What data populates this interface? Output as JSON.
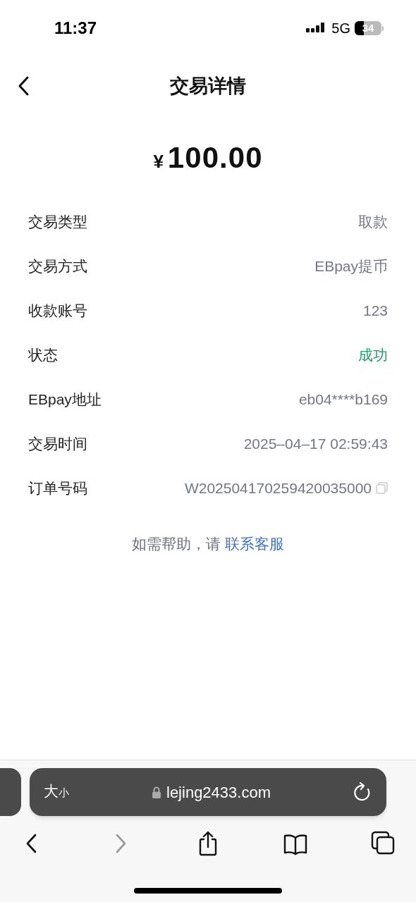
{
  "status_bar": {
    "time": "11:37",
    "network": "5G",
    "battery": "34"
  },
  "header": {
    "title": "交易详情"
  },
  "amount": {
    "currency": "¥",
    "value": "100.00"
  },
  "details": [
    {
      "label": "交易类型",
      "value": "取款",
      "kind": "text"
    },
    {
      "label": "交易方式",
      "value": "EBpay提币",
      "kind": "text"
    },
    {
      "label": "收款账号",
      "value": "123",
      "kind": "text"
    },
    {
      "label": "状态",
      "value": "成功",
      "kind": "success"
    },
    {
      "label": "EBpay地址",
      "value": "eb04****b169",
      "kind": "text"
    },
    {
      "label": "交易时间",
      "value": "2025–04–17 02:59:43",
      "kind": "text"
    },
    {
      "label": "订单号码",
      "value": "W202504170259420035000",
      "kind": "copy"
    }
  ],
  "help": {
    "text": "如需帮助，请",
    "link": "联系客服"
  },
  "browser": {
    "format_large": "大",
    "format_small": "小",
    "url": "lejing2433.com",
    "nav": [
      {
        "kind": "back",
        "disabled": false
      },
      {
        "kind": "forward",
        "disabled": true
      },
      {
        "kind": "share",
        "disabled": false
      },
      {
        "kind": "bookmarks",
        "disabled": false
      },
      {
        "kind": "tabs",
        "disabled": false
      }
    ]
  }
}
